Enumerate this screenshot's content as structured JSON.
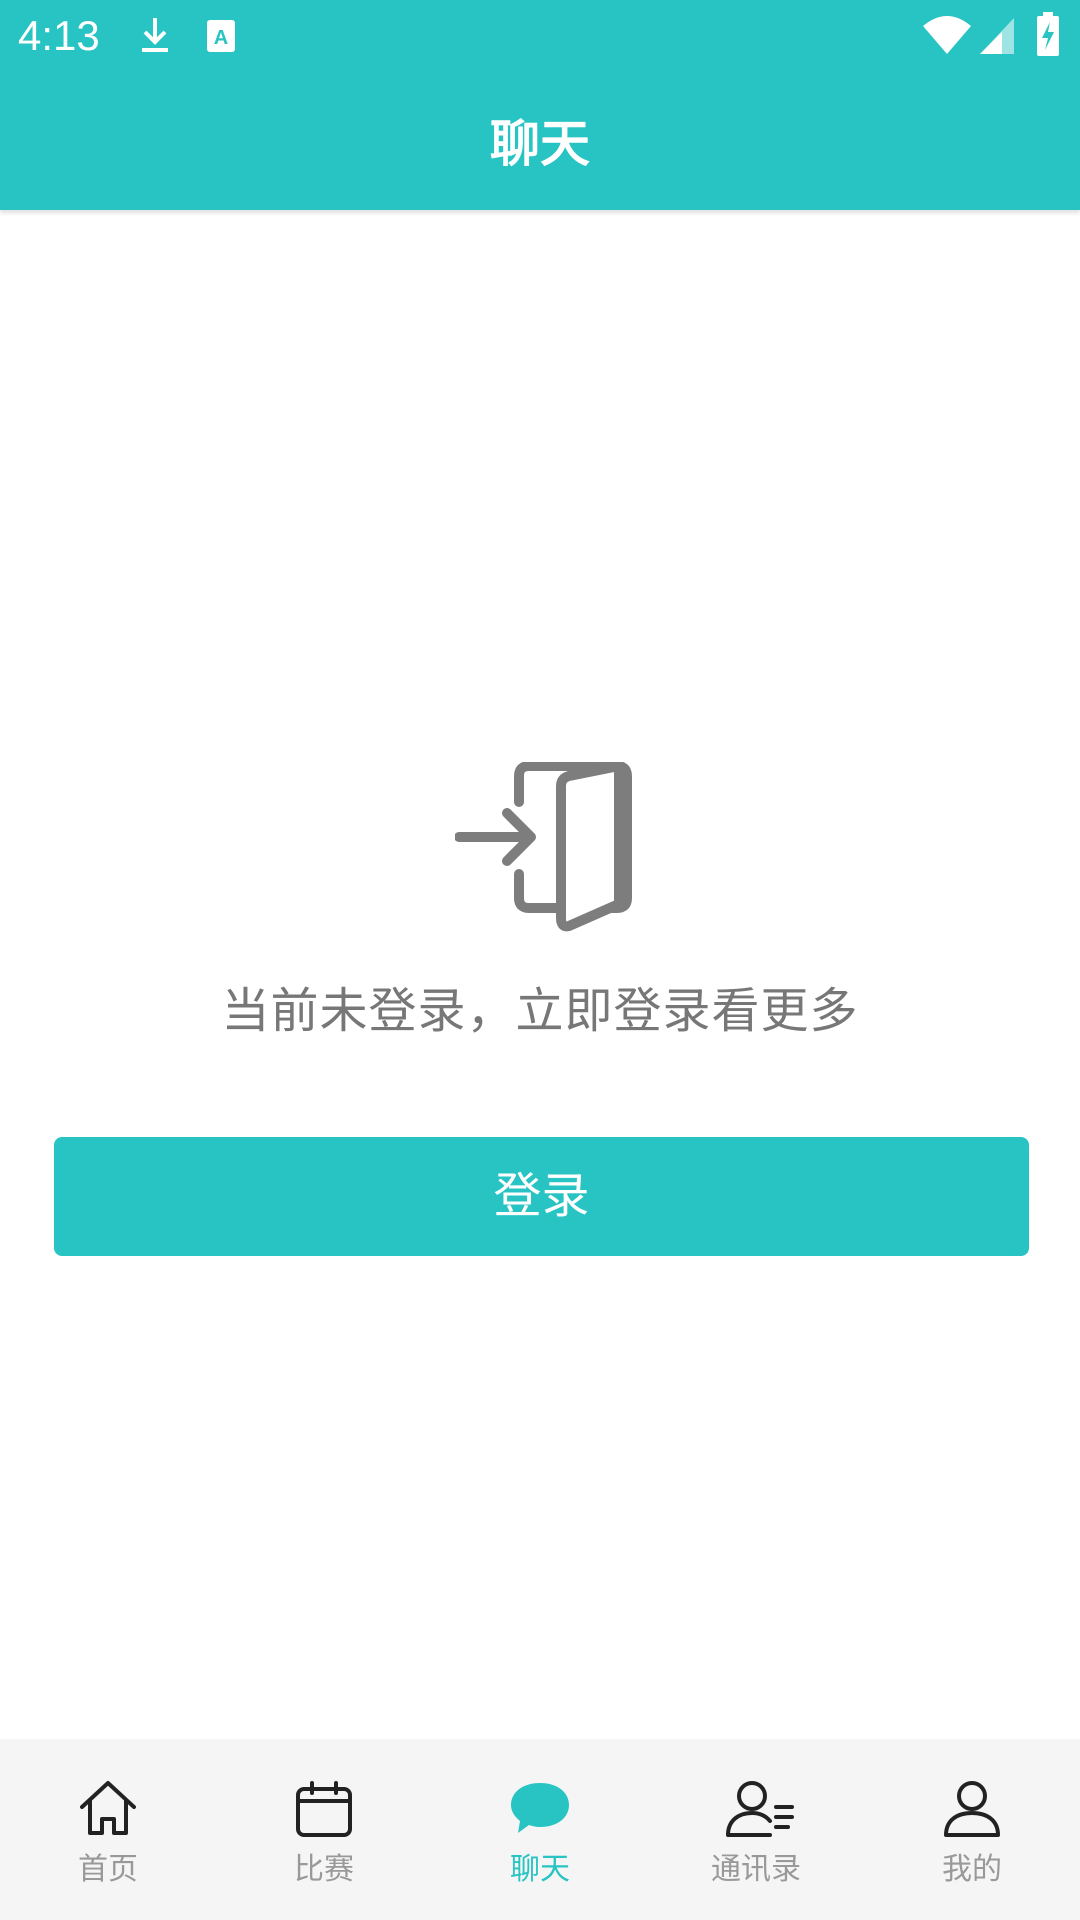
{
  "status_bar": {
    "time": "4:13",
    "icons": [
      "download-icon",
      "text-a-icon",
      "wifi-icon",
      "signal-icon",
      "battery-charging-icon"
    ]
  },
  "app_bar": {
    "title": "聊天"
  },
  "main": {
    "icon": "login-door-icon",
    "prompt": "当前未登录，立即登录看更多",
    "login_button": "登录"
  },
  "bottom_nav": {
    "items": [
      {
        "label": "首页",
        "icon": "home-icon",
        "active": false
      },
      {
        "label": "比赛",
        "icon": "calendar-icon",
        "active": false
      },
      {
        "label": "聊天",
        "icon": "chat-bubble-icon",
        "active": true
      },
      {
        "label": "通讯录",
        "icon": "contacts-icon",
        "active": false
      },
      {
        "label": "我的",
        "icon": "profile-icon",
        "active": false
      }
    ]
  },
  "colors": {
    "accent": "#28C4C4",
    "text_secondary": "#777777",
    "nav_inactive": "#999999",
    "nav_background": "#F5F5F5"
  }
}
